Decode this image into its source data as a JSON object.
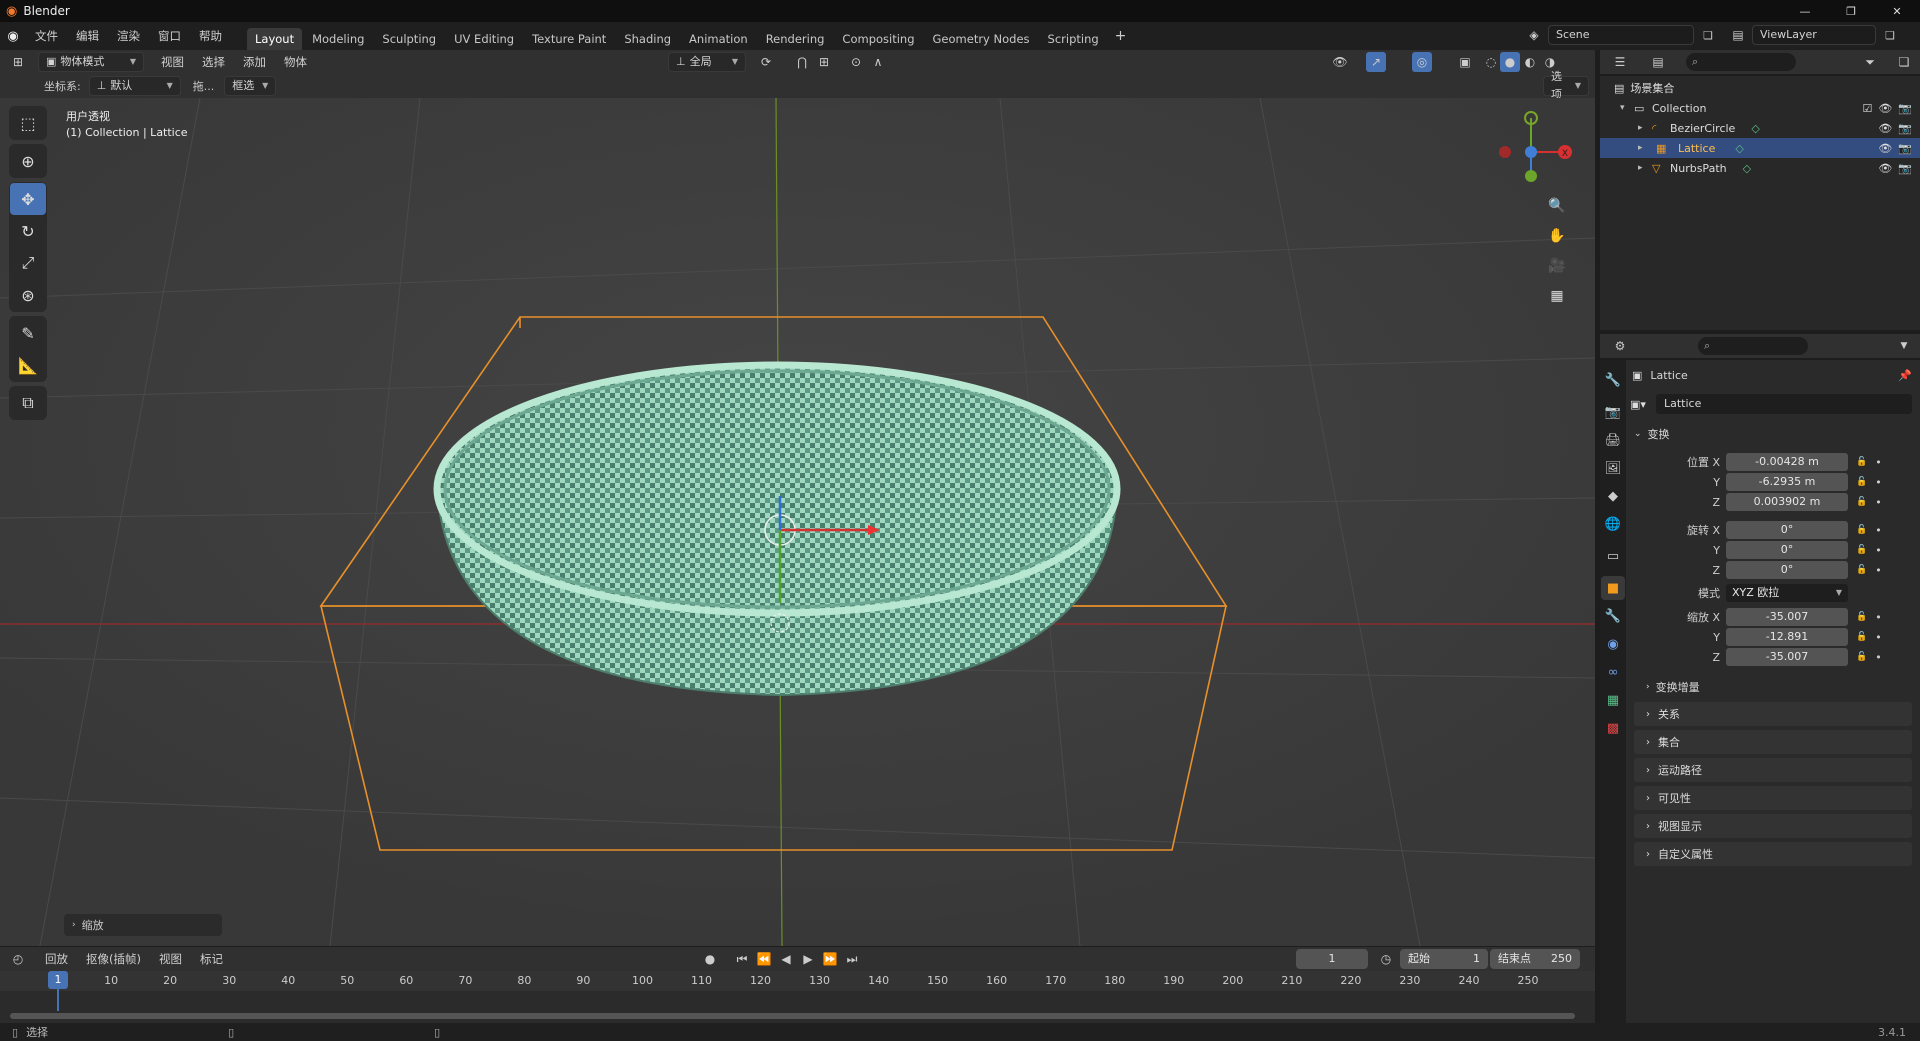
{
  "app": {
    "title": "Blender",
    "version": "3.4.1"
  },
  "menu": [
    "文件",
    "编辑",
    "渲染",
    "窗口",
    "帮助"
  ],
  "workspaces": [
    "Layout",
    "Modeling",
    "Sculpting",
    "UV Editing",
    "Texture Paint",
    "Shading",
    "Animation",
    "Rendering",
    "Compositing",
    "Geometry Nodes",
    "Scripting"
  ],
  "active_workspace": "Layout",
  "scene": {
    "name": "Scene",
    "view_layer": "ViewLayer"
  },
  "viewport_header": {
    "mode": "物体模式",
    "menus": [
      "视图",
      "选择",
      "添加",
      "物体"
    ],
    "orientation": "全局",
    "coord_label": "坐标系:",
    "coord_value": "默认",
    "drag_label": "拖...",
    "select_value": "框选",
    "options": "选项"
  },
  "viewport": {
    "view_name": "用户透视",
    "view_info": "(1) Collection | Lattice",
    "operator_panel": "缩放",
    "axes": {
      "x": "X",
      "y": "Y",
      "z": "Z"
    }
  },
  "outliner": {
    "root": "场景集合",
    "items": [
      {
        "name": "Collection",
        "level": 0
      },
      {
        "name": "BezierCircle",
        "level": 1
      },
      {
        "name": "Lattice",
        "level": 1,
        "selected": true
      },
      {
        "name": "NurbsPath",
        "level": 1
      }
    ]
  },
  "properties": {
    "object_name": "Lattice",
    "data_name": "Lattice",
    "transform_title": "变换",
    "location": {
      "label": "位置",
      "x": "-0.00428 m",
      "y": "-6.2935 m",
      "z": "0.003902 m"
    },
    "rotation": {
      "label": "旋转",
      "x": "0°",
      "y": "0°",
      "z": "0°"
    },
    "mode_label": "模式",
    "mode_value": "XYZ 欧拉",
    "scale": {
      "label": "缩放",
      "x": "-35.007",
      "y": "-12.891",
      "z": "-35.007"
    },
    "delta": "变换增量",
    "panels": [
      "关系",
      "集合",
      "运动路径",
      "可见性",
      "视图显示",
      "自定义属性"
    ]
  },
  "timeline": {
    "menus": [
      "回放",
      "抠像(插帧)",
      "视图",
      "标记"
    ],
    "current_frame": "1",
    "start_label": "起始",
    "start": "1",
    "end_label": "结束点",
    "end": "250",
    "ticks": [
      "1",
      "10",
      "20",
      "30",
      "40",
      "50",
      "60",
      "70",
      "80",
      "90",
      "100",
      "110",
      "120",
      "130",
      "140",
      "150",
      "160",
      "170",
      "180",
      "190",
      "200",
      "210",
      "220",
      "230",
      "240",
      "250"
    ]
  },
  "status": {
    "select": "选择"
  },
  "colors": {
    "accent": "#4772b3",
    "lattice": "#e8902a",
    "object_orange": "#f29a1c",
    "basket": "#7fbfa6"
  }
}
